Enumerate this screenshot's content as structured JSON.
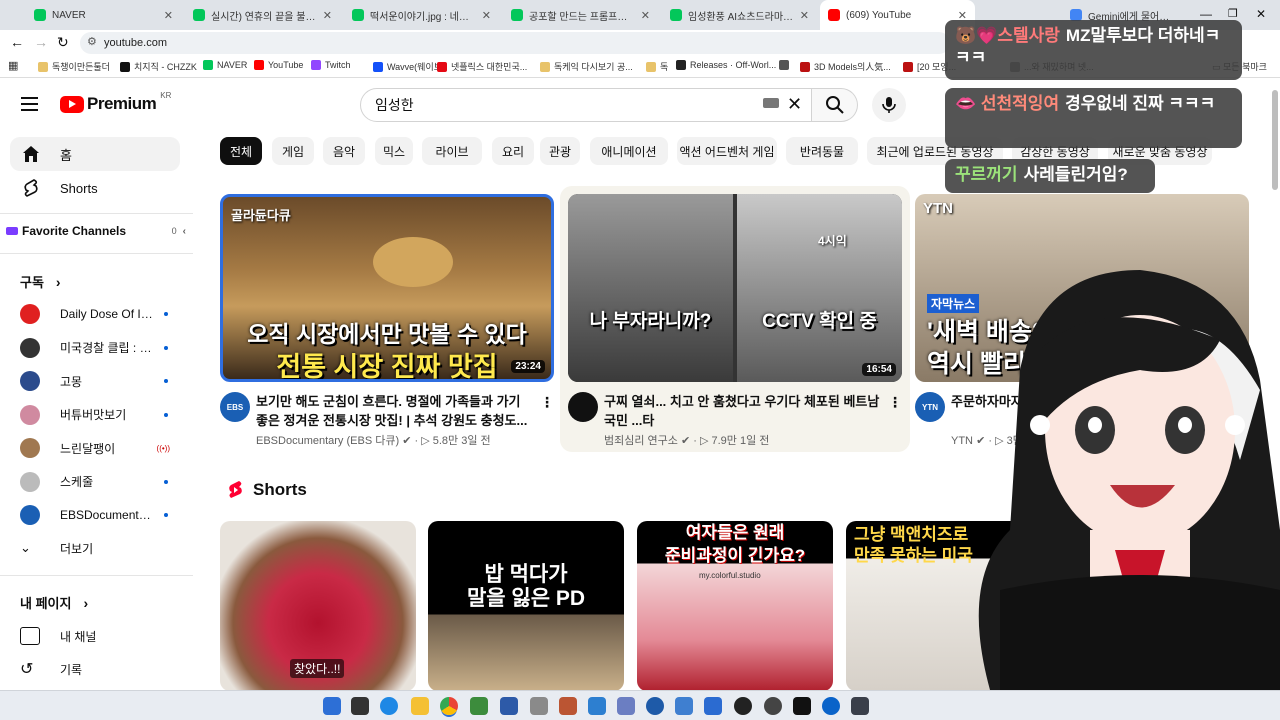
{
  "browser": {
    "tabs": [
      {
        "title": "NAVER",
        "color": "#03c75a"
      },
      {
        "title": "실시간) 연휴의 끝을 불태울 쇼",
        "color": "#03c75a"
      },
      {
        "title": "떡서운이야기.jpg : 네이버 카페",
        "color": "#03c75a"
      },
      {
        "title": "공포할 만드는 프롬프트 아카이",
        "color": "#03c75a"
      },
      {
        "title": "임성환풍 AI쇼츠드라마 : 네이버",
        "color": "#03c75a"
      },
      {
        "title": "(609) YouTube",
        "color": "#ff0000"
      },
      {
        "title": "Gemini에게 물어보기",
        "color": "#4285f4"
      }
    ],
    "url": "youtube.com",
    "bookmarks": [
      {
        "label": "독챙이만든툴더",
        "color": "#e8c36a"
      },
      {
        "label": "치지직 - CHZZK",
        "color": "#111111"
      },
      {
        "label": "NAVER",
        "color": "#03c75a"
      },
      {
        "label": "YouTube",
        "color": "#ff0000"
      },
      {
        "label": "Twitch",
        "color": "#9146ff"
      },
      {
        "label": "Wavve(웨이브)",
        "color": "#1351f9"
      },
      {
        "label": "넷플릭스 대한민국...",
        "color": "#e50914"
      },
      {
        "label": "독케익 다시보기 공...",
        "color": "#e8c36a"
      },
      {
        "label": "독",
        "color": "#e8c36a"
      },
      {
        "label": "Releases · Off-Worl...",
        "color": "#222222"
      },
      {
        "label": "",
        "color": "#555555"
      },
      {
        "label": "3D Models의人気...",
        "color": "#b11"
      },
      {
        "label": "[20 모잉...",
        "color": "#b11"
      },
      {
        "label": "...와 재밌하며 넷...",
        "color": "#888888"
      }
    ],
    "all_bookmarks": "모든 북마크"
  },
  "youtube": {
    "logo_text": "Premium",
    "logo_region": "KR",
    "search_value": "임성한",
    "sidebar": {
      "home": "홈",
      "shorts": "Shorts",
      "favorite": "Favorite Channels",
      "favorite_count": "0",
      "subscriptions": "구독",
      "channels": [
        {
          "name": "Daily Dose Of Int...",
          "color": "#e02020",
          "indicator": "dot"
        },
        {
          "name": "미국경찰 클립 : 미...",
          "color": "#333333",
          "indicator": "dot"
        },
        {
          "name": "고몽",
          "color": "#2b4b8c",
          "indicator": "dot"
        },
        {
          "name": "버튜버맛보기",
          "color": "#d08aa0",
          "indicator": "dot"
        },
        {
          "name": "느린달팽이",
          "color": "#a07850",
          "indicator": "live"
        },
        {
          "name": "스케줄",
          "color": "#bbbbbb",
          "indicator": "dot"
        },
        {
          "name": "EBSDocumentar...",
          "color": "#1a5fb4",
          "indicator": "dot"
        }
      ],
      "more": "더보기",
      "my_page": "내 페이지",
      "my_channel": "내 채널",
      "history": "기록"
    },
    "chips": [
      "전체",
      "게임",
      "음악",
      "믹스",
      "라이브",
      "요리",
      "관광",
      "애니메이션",
      "액션 어드벤처 게임",
      "반려동물",
      "최근에 업로드된 동영상",
      "감상한 동영상",
      "새로운 맞춤 동영상"
    ],
    "videos": [
      {
        "title": "보기만 해도 군침이 흐른다. 명절에 가족들과 가기 좋은 정겨운 전통시장 맛집! | 추석 강원도 충청도...",
        "channel": "EBSDocumentary (EBS 다큐)",
        "views": "5.8만",
        "age": "3일 전",
        "duration": "23:24",
        "overlay_top": "오직 시장에서만 맛볼 수 있다",
        "overlay_bottom": "전통 시장 진짜 맛집",
        "badge": "골라듄다큐"
      },
      {
        "title": "구찌 열쇠... 치고 안 훔쳤다고 우기다 체포된 베트남 국민 ...타",
        "channel": "범죄심리 연구소",
        "views": "7.9만",
        "age": "1일 전",
        "duration": "16:54",
        "overlay_left": "나 부자라니까?",
        "overlay_right": "CCTV 확인 중",
        "badge": "4시익"
      },
      {
        "title": "주문하자마자 ... 스! / YTN",
        "channel": "YTN",
        "views": "3만",
        "age": "",
        "badge": "YTN",
        "overlay_tag": "자막뉴스",
        "overlay_top": "'새벽 배송?",
        "overlay_bottom": "역시 빨리"
      }
    ],
    "shorts_heading": "Shorts",
    "shorts": [
      {
        "overlay": "찾았다..!!"
      },
      {
        "overlay": "밥 먹다가\n말을 잃은 PD"
      },
      {
        "overlay": "여자들은 원래\n준비과정이 긴가요?",
        "sub": "my.colorful.studio"
      },
      {
        "overlay": "그냥 맥앤치즈로\n만족 못하는 미국"
      }
    ]
  },
  "chat": [
    {
      "name": "스텔사랑",
      "name_color": "#ff7a7a",
      "message": "MZ말투보다 더하네ㅋㅋㅋ"
    },
    {
      "name": "선천적잉여",
      "name_color": "#ff8a7a",
      "message": "경우없네 진짜 ㅋㅋㅋ"
    },
    {
      "name": "꾸르꺼기",
      "name_color": "#9be27a",
      "message": "사레들린거임?"
    }
  ]
}
